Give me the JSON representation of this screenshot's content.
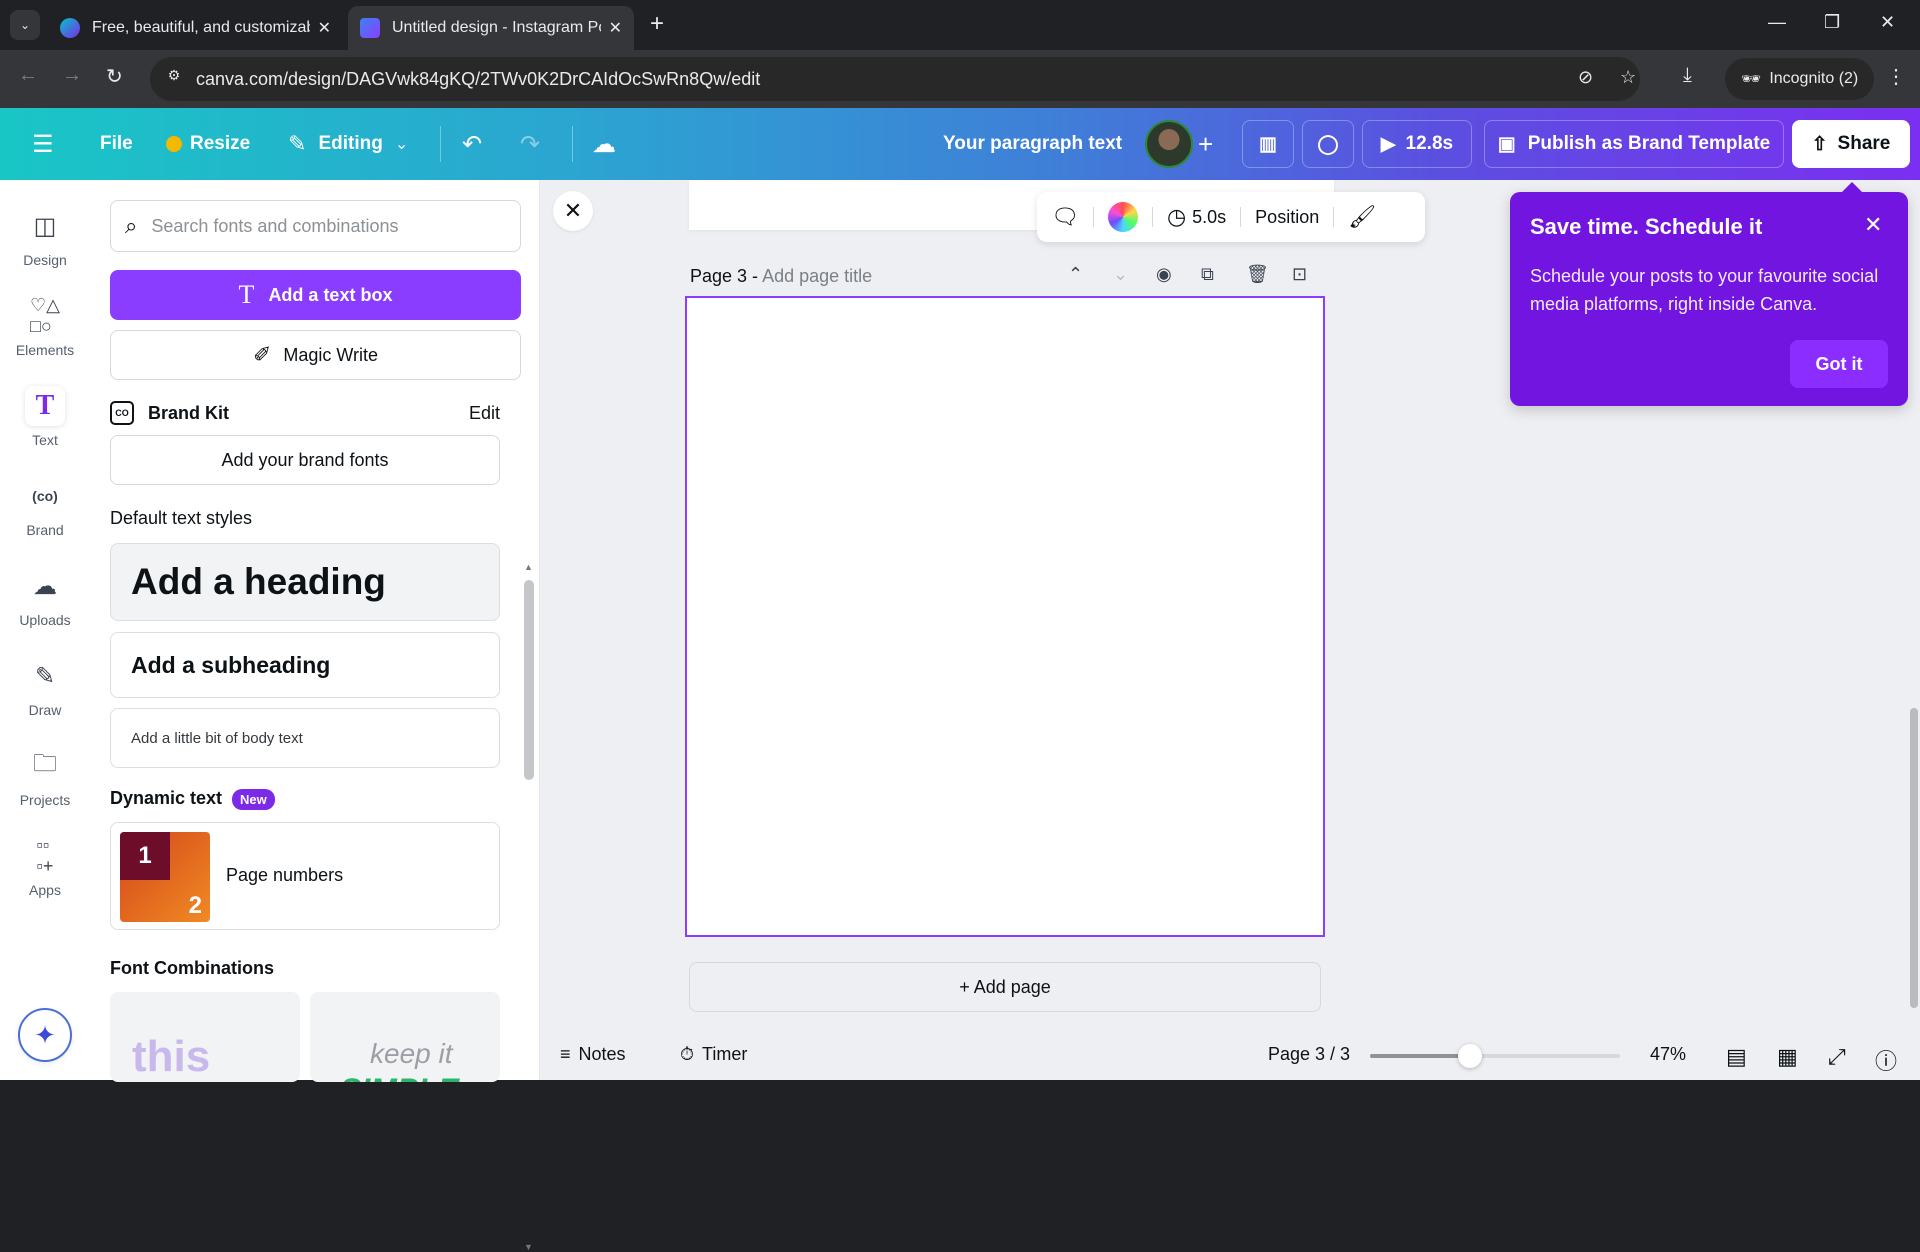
{
  "browser": {
    "tabs": [
      {
        "title": "Free, beautiful, and customizable",
        "active": false
      },
      {
        "title": "Untitled design - Instagram Post",
        "active": true
      }
    ],
    "url": "canva.com/design/DAGVwk84gKQ/2TWv0K2DrCAIdOcSwRn8Qw/edit",
    "incognito_label": "Incognito (2)"
  },
  "header": {
    "file": "File",
    "resize": "Resize",
    "editing": "Editing",
    "design_title": "Your paragraph text",
    "play_duration": "12.8s",
    "publish": "Publish as Brand Template",
    "share": "Share"
  },
  "rail": {
    "items": [
      {
        "label": "Design",
        "icon": "design-icon"
      },
      {
        "label": "Elements",
        "icon": "elements-icon"
      },
      {
        "label": "Text",
        "icon": "text-icon",
        "active": true
      },
      {
        "label": "Brand",
        "icon": "brand-icon"
      },
      {
        "label": "Uploads",
        "icon": "uploads-icon"
      },
      {
        "label": "Draw",
        "icon": "draw-icon"
      },
      {
        "label": "Projects",
        "icon": "projects-icon"
      },
      {
        "label": "Apps",
        "icon": "apps-icon"
      }
    ]
  },
  "panel": {
    "search_placeholder": "Search fonts and combinations",
    "add_text_box": "Add a text box",
    "magic_write": "Magic Write",
    "brand_kit": "Brand Kit",
    "brand_kit_edit": "Edit",
    "add_brand_fonts": "Add your brand fonts",
    "default_styles_title": "Default text styles",
    "heading": "Add a heading",
    "subheading": "Add a subheading",
    "body": "Add a little bit of body text",
    "dynamic_text_title": "Dynamic text",
    "new_badge": "New",
    "page_numbers": "Page numbers",
    "page_numbers_thumb": [
      "1",
      "2"
    ],
    "font_combinations_title": "Font Combinations",
    "combo1": "this",
    "combo2_line1": "keep it",
    "combo2_line2": "SIMPLE"
  },
  "canvas": {
    "toolbar_duration": "5.0s",
    "toolbar_position": "Position",
    "page_label": "Page 3 -",
    "page_title_placeholder": "Add page title",
    "add_page": "+ Add page"
  },
  "footer": {
    "notes": "Notes",
    "timer": "Timer",
    "page_indicator": "Page 3 / 3",
    "zoom_percent": 47,
    "zoom_label": "47%"
  },
  "popover": {
    "title": "Save time. Schedule it",
    "body": "Schedule your posts to your favourite social media platforms, right inside Canva.",
    "button": "Got it"
  },
  "colors": {
    "accent": "#8b3dff",
    "popover": "#7315e0"
  }
}
